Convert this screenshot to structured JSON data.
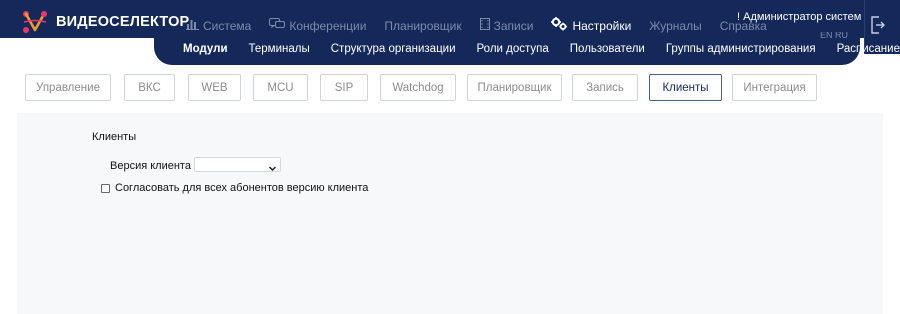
{
  "brand": {
    "name": "ВИДЕОСЕЛЕКТОР"
  },
  "main_nav": [
    {
      "label": "Система",
      "icon": "bar-chart-icon",
      "active": false
    },
    {
      "label": "Конференции",
      "icon": "chat-bubbles-icon",
      "active": false
    },
    {
      "label": "Планировщик",
      "icon": "",
      "active": false
    },
    {
      "label": "Записи",
      "icon": "film-icon",
      "active": false
    },
    {
      "label": "Настройки",
      "icon": "gears-icon",
      "active": true
    },
    {
      "label": "Журналы",
      "icon": "",
      "active": false
    },
    {
      "label": "Справка",
      "icon": "",
      "active": false
    }
  ],
  "user": {
    "label": "! Администратор систем"
  },
  "lang": {
    "label": "EN RU"
  },
  "sub_nav": [
    {
      "label": "Модули",
      "active": true
    },
    {
      "label": "Терминалы",
      "active": false
    },
    {
      "label": "Структура организации",
      "active": false
    },
    {
      "label": "Роли доступа",
      "active": false
    },
    {
      "label": "Пользователи",
      "active": false
    },
    {
      "label": "Группы администрирования",
      "active": false
    },
    {
      "label": "Расписание",
      "active": false
    }
  ],
  "tabs": [
    {
      "label": "Управление",
      "active": false
    },
    {
      "label": "ВКС",
      "active": false
    },
    {
      "label": "WEB",
      "active": false
    },
    {
      "label": "MCU",
      "active": false
    },
    {
      "label": "SIP",
      "active": false
    },
    {
      "label": "Watchdog",
      "active": false
    },
    {
      "label": "Планировщик",
      "active": false
    },
    {
      "label": "Запись",
      "active": false
    },
    {
      "label": "Клиенты",
      "active": true
    },
    {
      "label": "Интеграция",
      "active": false
    }
  ],
  "section": {
    "title": "Клиенты",
    "version_label": "Версия клиента",
    "version_value": "",
    "sync_checkbox_label": "Согласовать для всех абонентов версию клиента",
    "sync_checked": false
  },
  "colors": {
    "navy": "#14285a",
    "nav_inactive": "#7e8aa8",
    "accent_pink": "#e8376a",
    "accent_orange": "#f39a2b"
  }
}
